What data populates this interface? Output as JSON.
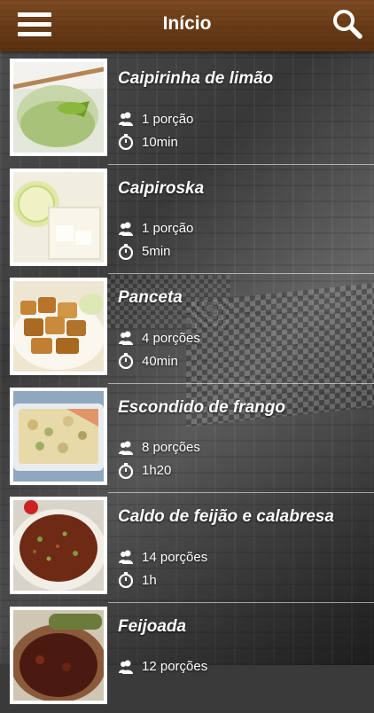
{
  "header": {
    "title": "Início",
    "menu_icon": "hamburger-menu-icon",
    "search_icon": "search-icon",
    "color": "#6a3c18"
  },
  "recipes": [
    {
      "name": "Caipirinha de limão",
      "portions": "1 porção",
      "time": "10min",
      "thumb": "lime-drink-photo"
    },
    {
      "name": "Caipiroska",
      "portions": "1 porção",
      "time": "5min",
      "thumb": "lemon-drink-photo"
    },
    {
      "name": "Panceta",
      "portions": "4 porções",
      "time": "40min",
      "thumb": "fried-pork-photo"
    },
    {
      "name": "Escondido de frango",
      "portions": "8 porções",
      "time": "1h20",
      "thumb": "chicken-casserole-photo"
    },
    {
      "name": "Caldo de feijão e calabresa",
      "portions": "14 porções",
      "time": "1h",
      "thumb": "bean-soup-photo"
    },
    {
      "name": "Feijoada",
      "portions": "12 porções",
      "time": "",
      "thumb": "feijoada-photo"
    }
  ]
}
